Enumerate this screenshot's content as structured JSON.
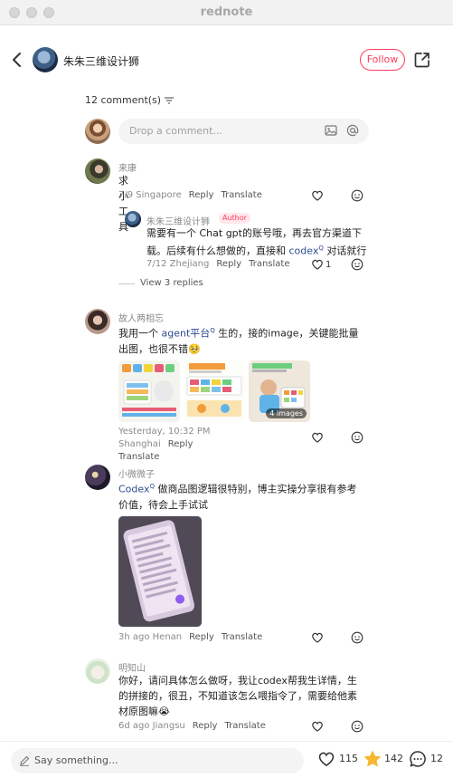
{
  "window": {
    "title": "rednote"
  },
  "header": {
    "author_name": "朱朱三维设计狮",
    "follow_label": "Follow"
  },
  "comments_count": "12 comment(s)",
  "compose": {
    "placeholder": "Drop a comment..."
  },
  "comments": [
    {
      "user": "来康",
      "text": "求小工具",
      "meta": "7/9 Singapore",
      "reply_label": "Reply",
      "translate_label": "Translate",
      "reply": {
        "user": "朱朱三维设计狮",
        "badge": "Author",
        "text_a": "需要有一个 Chat gpt的账号哦，再去官方渠道下载。后续有什么想做的，直接和 ",
        "link": "codex",
        "text_b": " 对话就行",
        "meta": "7/12 Zhejiang",
        "reply_label": "Reply",
        "translate_label": "Translate",
        "likes": "1"
      },
      "view_replies": "View 3 replies"
    },
    {
      "user": "故人两相忘",
      "text_a": "我用一个 ",
      "link": "agent平台",
      "text_b": " 生的，接的image，关键能批量出图，也很不错🥺",
      "images_badge": "4 images",
      "meta": "Yesterday, 10:32 PM Shanghai",
      "reply_label": "Reply",
      "translate_label": "Translate"
    },
    {
      "user": "小微微子",
      "link": "Codex",
      "text_b": " 做商品图逻辑很特别，博主实操分享很有参考价值，待会上手试试",
      "meta": "3h ago Henan",
      "reply_label": "Reply",
      "translate_label": "Translate"
    },
    {
      "user": "明知山",
      "text": "你好，请问具体怎么做呀，我让codex帮我生详情，生的拼接的，很丑，不知道该怎么喂指令了，需要给他素材原图嘛😭",
      "meta": "6d ago Jiangsu",
      "reply_label": "Reply",
      "translate_label": "Translate"
    }
  ],
  "bottom_bar": {
    "say_placeholder": "Say something...",
    "likes": "115",
    "stars": "142",
    "comments": "12"
  },
  "colors": {
    "accent": "#ff3b5c",
    "link": "#2a4d8f",
    "star": "#f7b731"
  }
}
